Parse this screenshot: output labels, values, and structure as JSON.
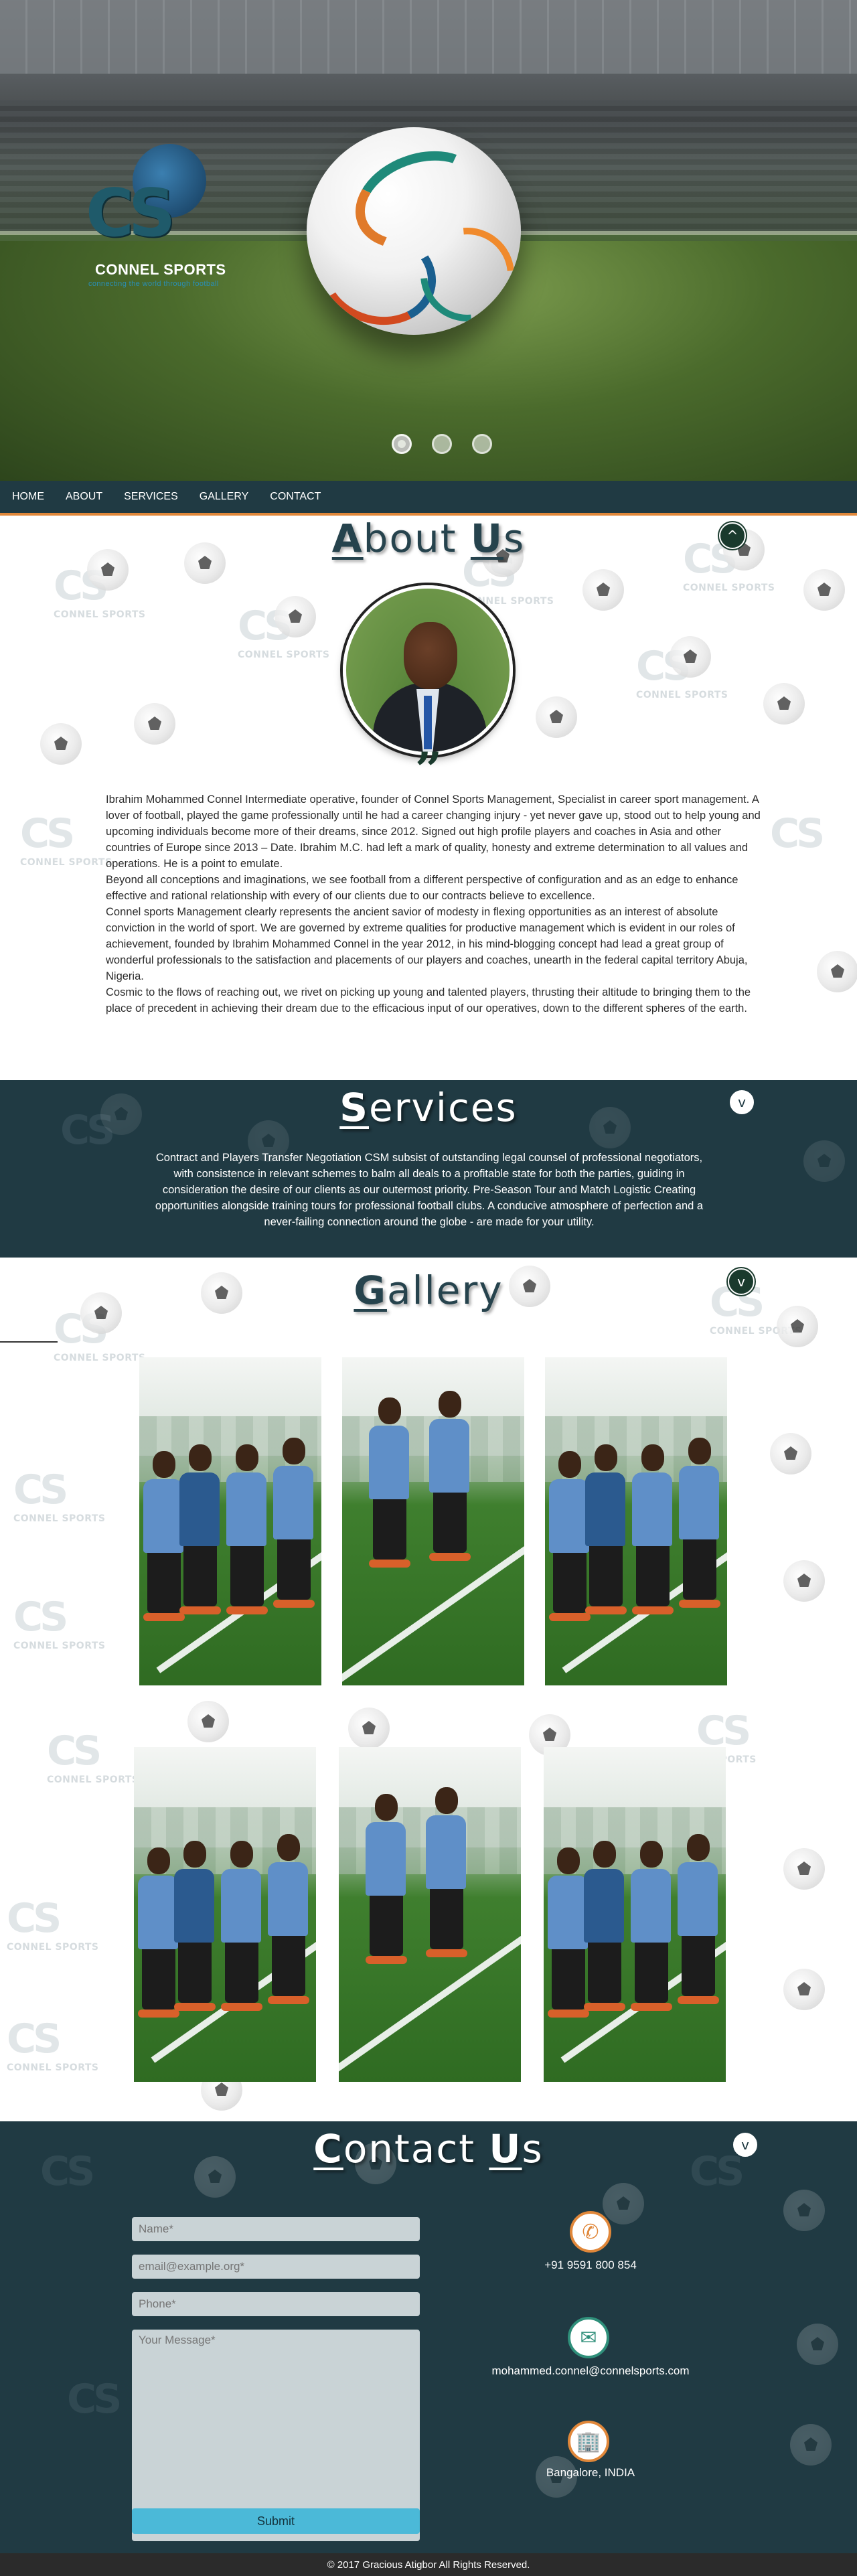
{
  "hero": {
    "logo_mark": "CS",
    "logo_name": "CONNEL SPORTS",
    "logo_tagline": "connecting the world through football",
    "slides": 3,
    "active_slide": 1
  },
  "nav": {
    "items": [
      "HOME",
      "ABOUT",
      "SERVICES",
      "GALLERY",
      "CONTACT"
    ]
  },
  "about": {
    "title_cap": "A",
    "title_rest": "bout ",
    "title_cap2": "U",
    "title_rest2": "s",
    "toggle_icon": "^",
    "quote_glyph": "”",
    "paragraphs": [
      "Ibrahim Mohammed Connel Intermediate operative, founder of Connel Sports Management, Specialist in career sport management. A lover of football, played the game professionally until he had a career changing injury - yet never gave up, stood out to help young and upcoming individuals become more of their dreams, since 2012. Signed out high profile players and coaches in Asia and other countries of Europe since 2013 – Date. Ibrahim M.C. had left a mark of quality, honesty and extreme determination to all values and operations. He is a point to emulate.",
      "Beyond all conceptions and imaginations, we see football from a different perspective of configuration and as an edge to enhance effective and rational relationship with every of our clients due to our contracts believe to excellence.",
      "Connel sports Management clearly represents the ancient savior of modesty in flexing opportunities as an interest of absolute conviction in the world of sport. We are governed by extreme qualities for productive management which is evident in our roles of achievement, founded by Ibrahim Mohammed Connel in the year 2012, in his mind-blogging concept had lead a great group of wonderful professionals to the satisfaction and placements of our players and coaches, unearth in the federal capital territory Abuja, Nigeria.",
      "Cosmic to the flows of reaching out, we rivet on picking up young and talented players, thrusting their altitude to bringing them to the place of precedent in achieving their dream due to the efficacious input of our operatives, down to the different spheres of the earth."
    ]
  },
  "services": {
    "title_cap": "S",
    "title_rest": "ervices",
    "toggle_icon": "v",
    "text": "Contract and Players Transfer Negotiation CSM subsist of outstanding legal counsel of professional negotiators, with consistence in relevant schemes to balm all deals to a profitable state for both the parties, guiding in consideration the desire of our clients as our outermost priority. Pre-Season Tour and Match Logistic Creating opportunities alongside training tours for professional football clubs. A conducive atmosphere of perfection and a never-failing connection around the globe - are made for your utility."
  },
  "gallery": {
    "title_cap": "G",
    "title_rest": "allery",
    "toggle_icon": "v",
    "photo_count": 6
  },
  "contact": {
    "title_cap": "C",
    "title_rest": "ontact ",
    "title_cap2": "U",
    "title_rest2": "s",
    "toggle_icon": "v",
    "name_placeholder": "Name*",
    "email_placeholder": "email@example.org*",
    "phone_placeholder": "Phone*",
    "message_placeholder": "Your Message*",
    "submit_label": "Submit",
    "phone": "+91 9591 800 854",
    "email": "mohammed.connel@connelsports.com",
    "location": "Bangalore, INDIA",
    "phone_icon": "phone-icon",
    "email_icon": "email-icon",
    "location_icon": "building-icon"
  },
  "footer": {
    "text": "© 2017 Gracious Atigbor All Rights Reserved."
  },
  "colors": {
    "dark_teal": "#203a43",
    "accent_orange": "#e0873a",
    "submit_blue": "#4bb9d8"
  }
}
